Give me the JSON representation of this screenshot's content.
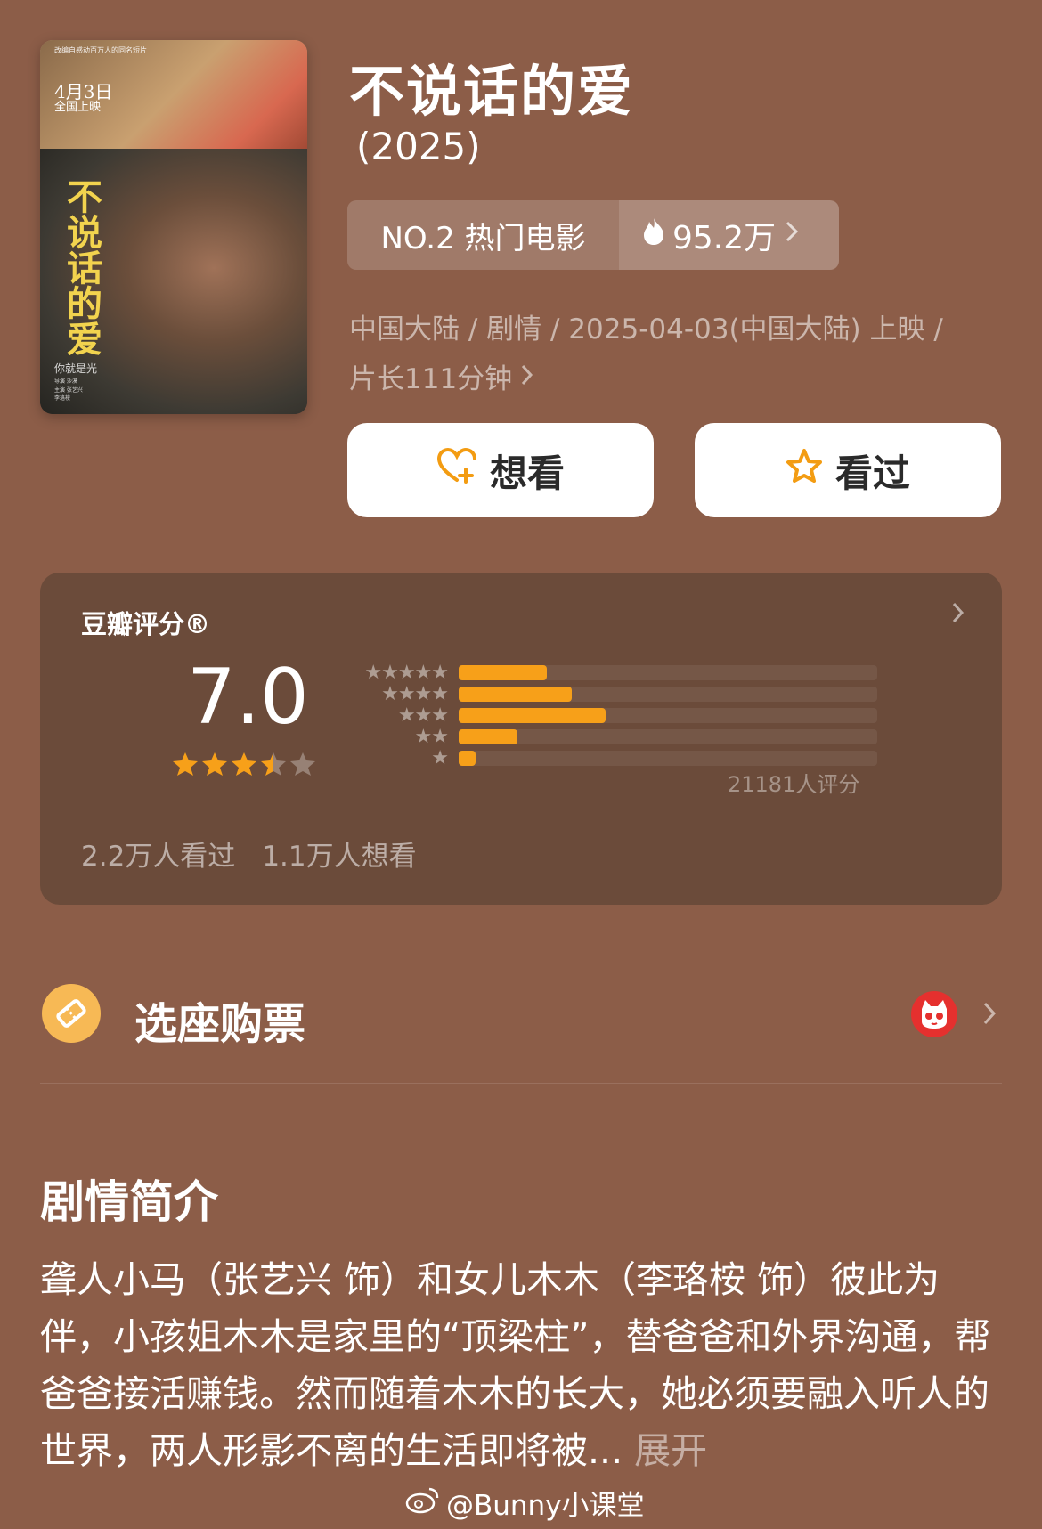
{
  "poster": {
    "tagline": "改编自感动百万人的同名短片",
    "release_date": "4月3日",
    "release_sub": "全国上映",
    "title_art": "不说话的爱",
    "slogan": "你就是光",
    "credits": [
      "导演 沙漠",
      "主演 张艺兴",
      "李珞桉"
    ]
  },
  "movie": {
    "title": "不说话的爱",
    "year": "(2025)",
    "rank_label": "NO.2 热门电影",
    "heat_value": "95.2万",
    "meta_line1": "中国大陆 / 剧情 / 2025-04-03(中国大陆) 上映 /",
    "meta_line2": "片长111分钟"
  },
  "actions": {
    "want_label": "想看",
    "seen_label": "看过"
  },
  "rating": {
    "label": "豆瓣评分®",
    "score": "7.0",
    "score_stars": 3.5,
    "count_text": "21181人评分",
    "watched_text": "2.2万人看过",
    "want_text": "1.1万人想看",
    "distribution": [
      {
        "stars": "★★★★★",
        "fraction": 0.21
      },
      {
        "stars": "★★★★",
        "fraction": 0.27
      },
      {
        "stars": "★★★",
        "fraction": 0.35
      },
      {
        "stars": "★★",
        "fraction": 0.14
      },
      {
        "stars": "★",
        "fraction": 0.04
      }
    ]
  },
  "ticket": {
    "label": "选座购票"
  },
  "synopsis": {
    "title": "剧情简介",
    "text": "聋人小马（张艺兴 饰）和女儿木木（李珞桉 饰）彼此为伴，小孩姐木木是家里的“顶梁柱”，替爸爸和外界沟通，帮爸爸接活赚钱。然而随着木木的长大，她必须要融入听人的世界，两人形影不离的生活即将被...",
    "more_label": " 展开"
  },
  "watermark": {
    "text": "@Bunny小课堂"
  },
  "colors": {
    "background": "#8c5d48",
    "card": "#6b4b3a",
    "accent": "#f7a019",
    "heart": "#f39c12"
  }
}
